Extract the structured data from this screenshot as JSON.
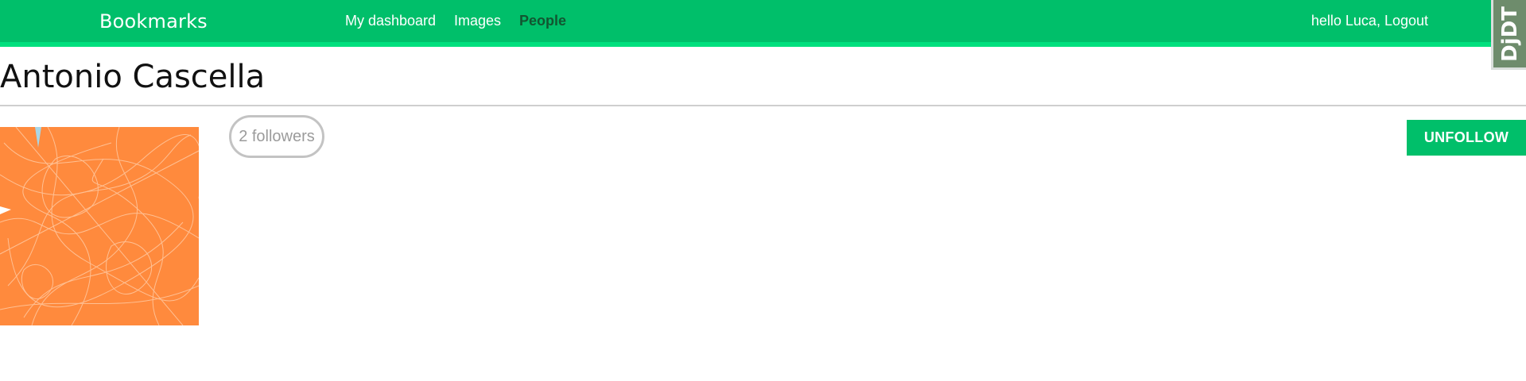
{
  "header": {
    "brand": "Bookmarks",
    "nav": [
      {
        "label": "My dashboard",
        "active": false
      },
      {
        "label": "Images",
        "active": false
      },
      {
        "label": "People",
        "active": true
      }
    ],
    "user_greeting": "hello Luca, Logout"
  },
  "debug_toolbar": {
    "label": "DjDT"
  },
  "profile": {
    "name": "Antonio Cascella",
    "followers": "2 followers",
    "follow_button": "UNFOLLOW"
  },
  "colors": {
    "brand_green": "#00bf6a",
    "active_nav": "#125631",
    "avatar_bg": "#ff8a3d"
  }
}
